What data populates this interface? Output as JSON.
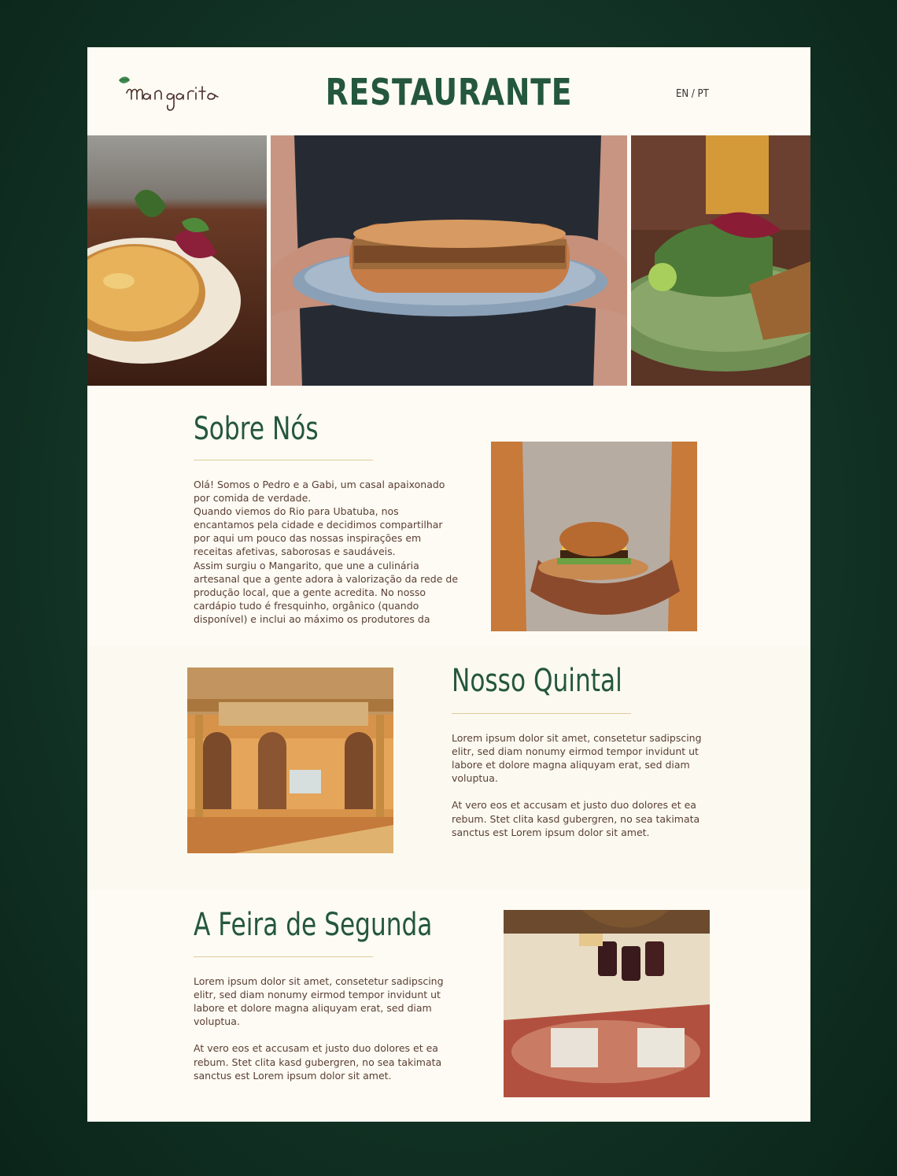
{
  "header": {
    "logo_text": "mangarito",
    "title": "RESTAURANTE",
    "lang_en": "EN",
    "lang_sep": "/",
    "lang_pt": "PT"
  },
  "sections": [
    {
      "title": "Sobre Nós",
      "body": "Olá! Somos o Pedro e a Gabi, um casal apaixonado\npor comida de verdade.\nQuando viemos do Rio para Ubatuba, nos\nencantamos pela cidade e decidimos compartilhar\npor aqui um pouco das nossas inspirações em\nreceitas afetivas, saborosas e saudáveis.\nAssim surgiu o Mangarito, que une a culinária\nartesanal que a gente adora à valorização da rede de\nprodução local, que a gente acredita. No nosso\ncardápio tudo é fresquinho, orgânico (quando\ndisponível) e inclui ao máximo os produtores da"
    },
    {
      "title": "Nosso Quintal",
      "body": "Lorem ipsum dolor sit amet, consetetur sadipscing\nelitr, sed diam nonumy eirmod tempor invidunt ut\nlabore et dolore magna aliquyam erat, sed diam\nvoluptua.\n\nAt vero eos et accusam et justo duo dolores et ea\nrebum. Stet clita kasd gubergren, no sea takimata\nsanctus est Lorem ipsum dolor sit amet."
    },
    {
      "title": "A Feira de Segunda",
      "body": "Lorem ipsum dolor sit amet, consetetur sadipscing\nelitr, sed diam nonumy eirmod tempor invidunt ut\nlabore et dolore magna aliquyam erat, sed diam\nvoluptua.\n\nAt vero eos et accusam et justo duo dolores et ea\nrebum. Stet clita kasd gubergren, no sea takimata\nsanctus est Lorem ipsum dolor sit amet."
    }
  ],
  "colors": {
    "brand_green": "#24573d",
    "background": "#0f2c20",
    "page": "#fdfbf3",
    "text": "#5a3e34",
    "rule": "#e1c99b"
  }
}
